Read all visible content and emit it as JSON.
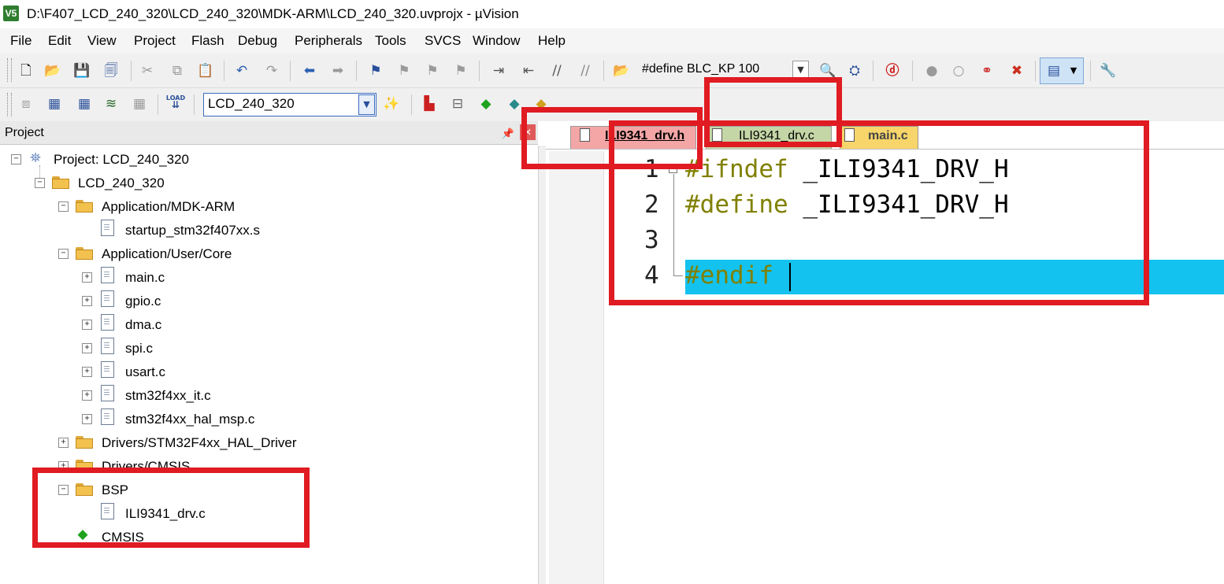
{
  "window": {
    "title": "D:\\F407_LCD_240_320\\LCD_240_320\\MDK-ARM\\LCD_240_320.uvprojx - µVision",
    "app_icon_text": "V5"
  },
  "menu": [
    "File",
    "Edit",
    "View",
    "Project",
    "Flash",
    "Debug",
    "Peripherals",
    "Tools",
    "SVCS",
    "Window",
    "Help"
  ],
  "toolbar": {
    "find_combo_value": "#define BLC_KP 100",
    "target_select_value": "LCD_240_320",
    "load_label": "LOAD"
  },
  "project_panel": {
    "title": "Project",
    "tree": [
      {
        "label": "Project: LCD_240_320",
        "expand": "−",
        "icon": "project-icon"
      },
      {
        "label": "LCD_240_320",
        "expand": "−",
        "icon": "target-folder-icon"
      },
      {
        "label": "Application/MDK-ARM",
        "expand": "−",
        "icon": "folder-icon"
      },
      {
        "label": "startup_stm32f407xx.s",
        "expand": "",
        "icon": "file-icon"
      },
      {
        "label": "Application/User/Core",
        "expand": "−",
        "icon": "folder-icon"
      },
      {
        "label": "main.c",
        "expand": "+",
        "icon": "file-icon"
      },
      {
        "label": "gpio.c",
        "expand": "+",
        "icon": "file-icon"
      },
      {
        "label": "dma.c",
        "expand": "+",
        "icon": "file-icon"
      },
      {
        "label": "spi.c",
        "expand": "+",
        "icon": "file-icon"
      },
      {
        "label": "usart.c",
        "expand": "+",
        "icon": "file-icon"
      },
      {
        "label": "stm32f4xx_it.c",
        "expand": "+",
        "icon": "file-icon"
      },
      {
        "label": "stm32f4xx_hal_msp.c",
        "expand": "+",
        "icon": "file-icon"
      },
      {
        "label": "Drivers/STM32F4xx_HAL_Driver",
        "expand": "+",
        "icon": "folder-icon"
      },
      {
        "label": "Drivers/CMSIS",
        "expand": "+",
        "icon": "folder-icon"
      },
      {
        "label": "BSP",
        "expand": "−",
        "icon": "folder-icon"
      },
      {
        "label": "ILI9341_drv.c",
        "expand": "",
        "icon": "file-icon"
      },
      {
        "label": "CMSIS",
        "expand": "",
        "icon": "cmsis-diamond-icon"
      }
    ]
  },
  "editor": {
    "tabs": [
      {
        "label": "ILI9341_drv.h",
        "active": true,
        "color": "#f4a6a6"
      },
      {
        "label": "ILI9341_drv.c",
        "active": false,
        "color": "#c4d6a6"
      },
      {
        "label": "main.c",
        "active": false,
        "color": "#f7d56a"
      }
    ],
    "lines": [
      {
        "num": "1",
        "directive": "#ifndef",
        "rest": " _ILI9341_DRV_H"
      },
      {
        "num": "2",
        "directive": "#define",
        "rest": " _ILI9341_DRV_H"
      },
      {
        "num": "3",
        "directive": "",
        "rest": ""
      },
      {
        "num": "4",
        "directive": "#endif",
        "rest": ""
      }
    ],
    "highlight_color": "#13c2ee",
    "directive_color": "#808000"
  },
  "annotation_color": "#e01b22"
}
